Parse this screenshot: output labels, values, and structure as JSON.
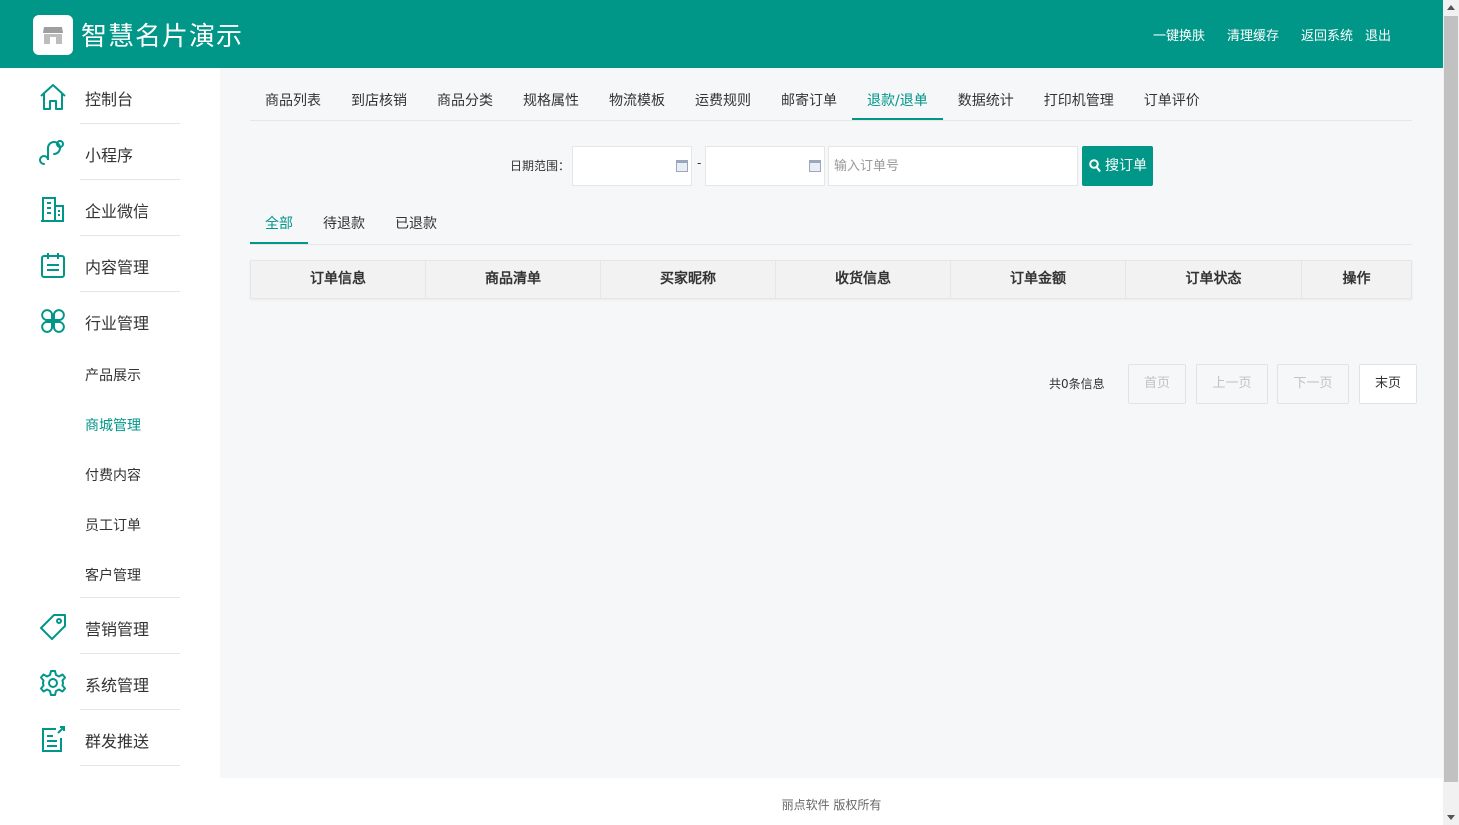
{
  "header": {
    "brand": "智慧名片演示",
    "links": [
      "一键换肤",
      "清理缓存",
      "返回系统",
      "退出"
    ]
  },
  "colors": {
    "primary": "#009688",
    "background": "#f5f7f9"
  },
  "sidebar": {
    "items": [
      {
        "label": "控制台",
        "icon": "home-icon"
      },
      {
        "label": "小程序",
        "icon": "miniprogram-icon"
      },
      {
        "label": "企业微信",
        "icon": "building-icon"
      },
      {
        "label": "内容管理",
        "icon": "calendar-icon"
      },
      {
        "label": "行业管理",
        "icon": "clover-icon"
      },
      {
        "label": "营销管理",
        "icon": "tag-icon"
      },
      {
        "label": "系统管理",
        "icon": "gear-icon"
      },
      {
        "label": "群发推送",
        "icon": "edit-document-icon"
      }
    ],
    "subitems": [
      "产品展示",
      "商城管理",
      "付费内容",
      "员工订单",
      "客户管理"
    ],
    "active_subitem": "商城管理"
  },
  "tabs": [
    "商品列表",
    "到店核销",
    "商品分类",
    "规格属性",
    "物流模板",
    "运费规则",
    "邮寄订单",
    "退款/退单",
    "数据统计",
    "打印机管理",
    "订单评价"
  ],
  "active_tab": "退款/退单",
  "search": {
    "date_label": "日期范围：",
    "dash": "-",
    "order_placeholder": "输入订单号",
    "button": "搜订单"
  },
  "subtabs": [
    "全部",
    "待退款",
    "已退款"
  ],
  "active_subtab": "全部",
  "table": {
    "columns": [
      "订单信息",
      "商品清单",
      "买家昵称",
      "收货信息",
      "订单金额",
      "订单状态",
      "操作"
    ],
    "rows": []
  },
  "pager": {
    "count_text": "共0条信息",
    "first": "首页",
    "prev": "上一页",
    "next": "下一页",
    "last": "末页"
  },
  "footer": "丽点软件 版权所有"
}
